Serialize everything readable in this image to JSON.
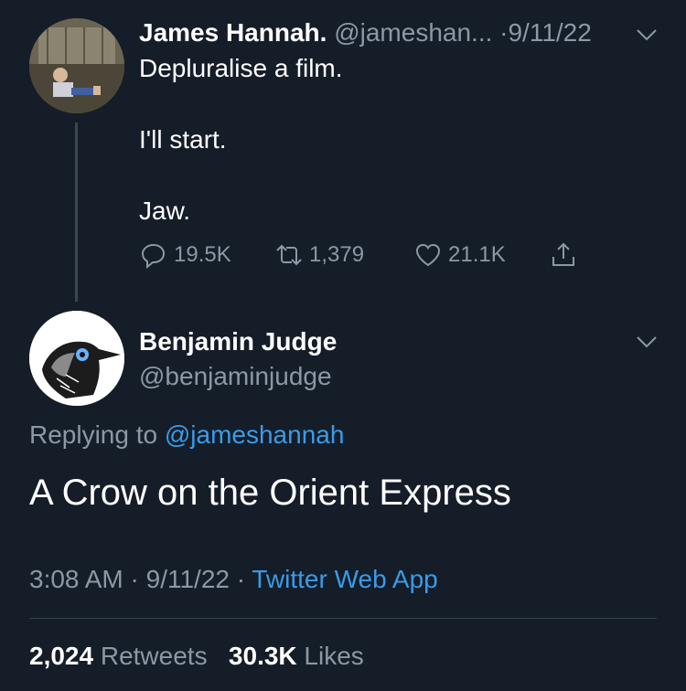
{
  "tweet1": {
    "name": "James Hannah.",
    "handle": "@jameshan...",
    "separator": "·",
    "date": "9/11/22",
    "lines": [
      "Depluralise a film.",
      "I'll start.",
      "Jaw."
    ],
    "actions": {
      "reply_count": "19.5K",
      "retweet_count": "1,379",
      "like_count": "21.1K"
    },
    "icons": [
      "chevron-down-icon",
      "reply-icon",
      "retweet-icon",
      "like-icon",
      "share-icon"
    ]
  },
  "tweet2": {
    "name": "Benjamin Judge",
    "handle": "@benjaminjudge",
    "replying_prefix": "Replying to",
    "replying_handle": "@jameshannah",
    "text": "A Crow on the Orient Express",
    "time": "3:08 AM",
    "sep": "·",
    "date": "9/11/22",
    "source": "Twitter Web App",
    "retweets_count": "2,024",
    "retweets_label": "Retweets",
    "likes_count": "30.3K",
    "likes_label": "Likes"
  },
  "colors": {
    "background": "#151d28",
    "muted_text": "#8b98a5",
    "link": "#3a9be8",
    "divider": "#38444d"
  }
}
